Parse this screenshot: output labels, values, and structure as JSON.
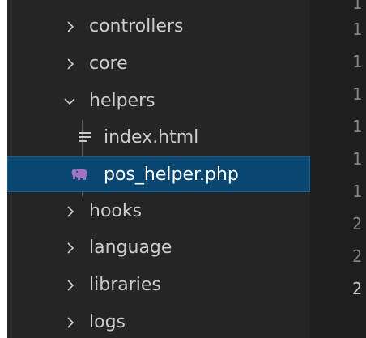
{
  "explorer": {
    "items": [
      {
        "label": "controllers",
        "kind": "folder",
        "state": "collapsed",
        "icon": "chevron-right-icon"
      },
      {
        "label": "core",
        "kind": "folder",
        "state": "collapsed",
        "icon": "chevron-right-icon"
      },
      {
        "label": "helpers",
        "kind": "folder",
        "state": "expanded",
        "icon": "chevron-down-icon"
      },
      {
        "label": "index.html",
        "kind": "file",
        "icon": "lines-document-icon"
      },
      {
        "label": "pos_helper.php",
        "kind": "file",
        "selected": true,
        "icon": "php-elephant-icon"
      },
      {
        "label": "hooks",
        "kind": "folder",
        "state": "collapsed",
        "icon": "chevron-right-icon"
      },
      {
        "label": "language",
        "kind": "folder",
        "state": "collapsed",
        "icon": "chevron-right-icon"
      },
      {
        "label": "libraries",
        "kind": "folder",
        "state": "collapsed",
        "icon": "chevron-right-icon"
      },
      {
        "label": "logs",
        "kind": "folder",
        "state": "collapsed",
        "icon": "chevron-right-icon"
      }
    ]
  },
  "editor": {
    "line_numbers": [
      "1",
      "1",
      "1",
      "1",
      "1",
      "1",
      "1",
      "2",
      "2",
      "2"
    ]
  },
  "colors": {
    "sidebar_background": "#252526",
    "editor_background": "#1e1e1e",
    "selection_background": "#094771",
    "selection_border": "#0e639c",
    "text": "#cccccc",
    "php_icon": "#a074c4",
    "line_number": "#858585"
  }
}
